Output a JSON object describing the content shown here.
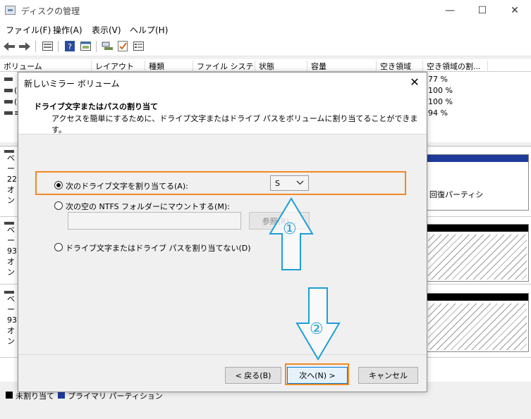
{
  "window": {
    "title": "ディスクの管理",
    "minimize_glyph": "—",
    "maximize_glyph": "☐",
    "close_glyph": "✕"
  },
  "menu": {
    "items": [
      {
        "label": "ファイル(F)"
      },
      {
        "label": "操作(A)"
      },
      {
        "label": "表示(V)"
      },
      {
        "label": "ヘルプ(H)"
      }
    ]
  },
  "toolbar": {
    "icons": [
      "back-icon",
      "forward-icon",
      "properties-icon",
      "help-icon",
      "console-icon",
      "connect-icon",
      "check-icon",
      "list-icon"
    ]
  },
  "table": {
    "columns": [
      "ボリューム",
      "レイアウト",
      "種類",
      "ファイル システム",
      "状態",
      "容量",
      "空き領域",
      "空き領域の割..."
    ],
    "rows": [
      {
        "prefix": "",
        "free_pct": "77 %"
      },
      {
        "prefix": "(",
        "free_pct": "100 %"
      },
      {
        "prefix": "(",
        "free_pct": "100 %"
      },
      {
        "prefix": "≡",
        "free_pct": "94 %"
      }
    ]
  },
  "disks": [
    {
      "line1": "ベー",
      "line2": "22:",
      "line3": "オン",
      "right_label": "回復パーティシ",
      "bar_color": "#1f3b9a"
    },
    {
      "line1": "ベー",
      "line2": "93",
      "line3": "オン",
      "right_label": "",
      "bar_color": "#000000"
    },
    {
      "line1": "ベー",
      "line2": "93",
      "line3": "オン",
      "right_label": "",
      "bar_color": "#000000"
    }
  ],
  "legend": {
    "unallocated": "未割り当て",
    "primary": "プライマリ パーティション",
    "unallocated_color": "#000000",
    "primary_color": "#1f3b9a"
  },
  "dialog": {
    "title": "新しいミラー ボリューム",
    "close_glyph": "✕",
    "heading": "ドライブ文字またはパスの割り当て",
    "subheading": "アクセスを簡単にするために、ドライブ文字またはドライブ パスをボリュームに割り当てることができます。",
    "options": [
      {
        "label": "次のドライブ文字を割り当てる(A):",
        "selected": true
      },
      {
        "label": "次の空の NTFS フォルダーにマウントする(M):",
        "selected": false
      },
      {
        "label": "ドライブ文字またはドライブ パスを割り当てない(D)",
        "selected": false
      }
    ],
    "drive_letter": "S",
    "path_value": "",
    "browse_label": "参照(R)...",
    "back_label": "< 戻る(B)",
    "next_label": "次へ(N) >",
    "cancel_label": "キャンセル"
  },
  "annotations": {
    "step1": "①",
    "step2": "②",
    "highlight_color": "#f08a24",
    "arrow_color": "#1c9fd8"
  }
}
